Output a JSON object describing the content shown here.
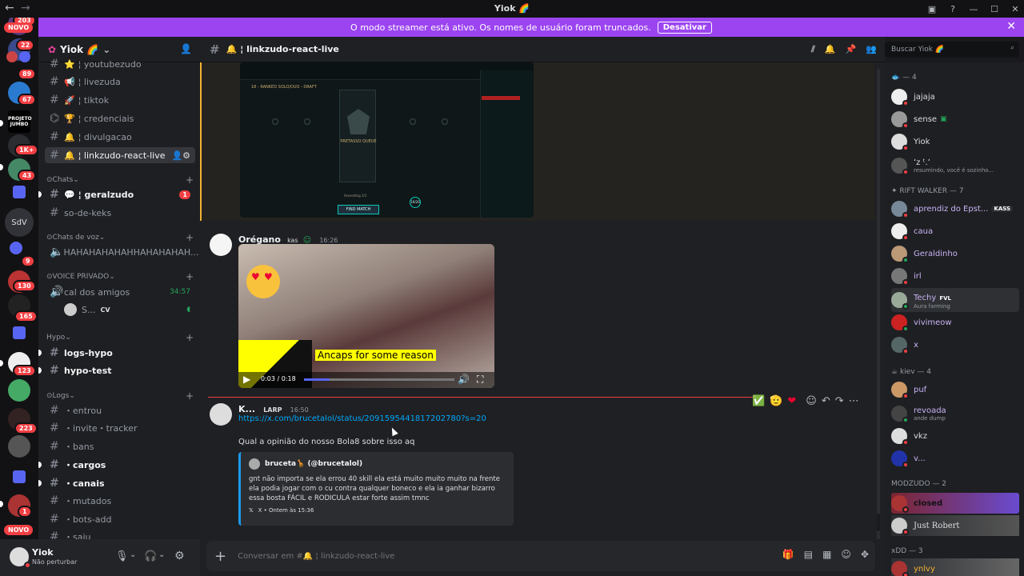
{
  "window": {
    "title": "Yiok 🌈"
  },
  "banner": {
    "text": "O modo streamer está ativo. Os nomes de usuário foram truncados.",
    "button": "Desativar"
  },
  "servers": {
    "badges": [
      "203",
      "22",
      "89",
      "67",
      "1K+",
      "43",
      "9",
      "130",
      "165",
      "123",
      "223",
      "1"
    ],
    "novo": "NOVO",
    "sdv": "SdV"
  },
  "guild": {
    "name": "Yiok 🌈"
  },
  "channels": [
    {
      "name": "¦ youtubezudo",
      "emoji": "⭐"
    },
    {
      "name": "¦ livezuda",
      "emoji": "📢"
    },
    {
      "name": "¦ tiktok",
      "emoji": "🚀"
    },
    {
      "name": "¦ credenciais",
      "emoji": "🏆"
    },
    {
      "name": "¦ divulgacao",
      "emoji": "🔔"
    },
    {
      "name": "¦ linkzudo-react-live",
      "emoji": "🔔"
    }
  ],
  "categories": {
    "chats": "Chats",
    "voz": "Chats de voz",
    "privado": "VOICE PRIVADO",
    "hypo": "Hypo",
    "logs": "Logs"
  },
  "chats": [
    {
      "name": "¦ geralzudo",
      "badge": "1"
    },
    {
      "name": "so-de-keks"
    }
  ],
  "voice": [
    {
      "name": "HAHAHAHAHAHHAHAHAHAH..."
    }
  ],
  "privado": [
    {
      "name": "cal dos amigos",
      "time": "34:57"
    },
    {
      "user": "S...",
      "tag": "CV"
    }
  ],
  "hypo": [
    {
      "name": "logs-hypo"
    },
    {
      "name": "hypo-test"
    }
  ],
  "logs": [
    {
      "name": "・entrou"
    },
    {
      "name": "・invite・tracker"
    },
    {
      "name": "・bans"
    },
    {
      "name": "・cargos"
    },
    {
      "name": "・canais"
    },
    {
      "name": "・mutados"
    },
    {
      "name": "・bots-add"
    },
    {
      "name": "・saiu"
    }
  ],
  "user": {
    "name": "Yiok",
    "status": "Não perturbar"
  },
  "header": {
    "channel": "¦ linkzudo-react-live",
    "search": "Buscar Yiok 🌈"
  },
  "messages": [
    {
      "author": "Orégano",
      "tag": "kas",
      "time": "16:26",
      "video": {
        "caption": "Ancaps for some reason",
        "progress_text": "0:03 / 0:18",
        "progress": 0.17
      }
    },
    {
      "author": "K...",
      "tag": "LARP",
      "time": "16:50",
      "link": "https://x.com/brucetalol/status/2091595441817202780?s=20",
      "text": "Qual a opinião do nosso Bola8 sobre isso aq",
      "embed": {
        "author": "bruceta🦒 (@brucetalol)",
        "body": "gnt não importa se ela errou 40 skill ela está muito muito muito na frente ela podia jogar com o cu contra qualquer boneco e ela ia ganhar bizarro essa bosta FÁCIL e RODICULA estar forte assim tmnc",
        "footer": "X • Ontem às 15:36"
      }
    }
  ],
  "game": {
    "mode": "18 - RANKED SOLO/DUO - DRAFT",
    "queue": "PRETASSO QUEUE",
    "find_match": "FIND MATCH",
    "timer": "16/20",
    "ascend": "Ascending 1/1"
  },
  "composer": {
    "placeholder": "Conversar em #🔔 ¦ linkzudo-react-live"
  },
  "members": {
    "groups": [
      {
        "title": "— 4",
        "members": [
          "jajaja",
          "sense",
          "Yiok",
          "ʻz⁠ ᵗ.ʻ"
        ]
      },
      {
        "title": "RIFT WALKER — 7",
        "members": [
          "aprendiz do Epst...",
          "caua",
          "Geraldinho",
          "irl",
          "Techy",
          "vivimeow",
          "x"
        ]
      },
      {
        "title": "kiev — 4",
        "members": [
          "puf",
          "revoada",
          "vkz",
          "v..."
        ]
      },
      {
        "title": "MODZUDO — 2",
        "members": [
          "closed",
          "Just Robert"
        ]
      },
      {
        "title": "xDD — 3",
        "members": [
          "ynlvy"
        ]
      }
    ],
    "subs": {
      "sozinho": "resumindo, você é sozinho...",
      "techy": "Aura farming",
      "revoada": "ande dump",
      "kass": "KASS",
      "fvl": "FVL"
    }
  }
}
